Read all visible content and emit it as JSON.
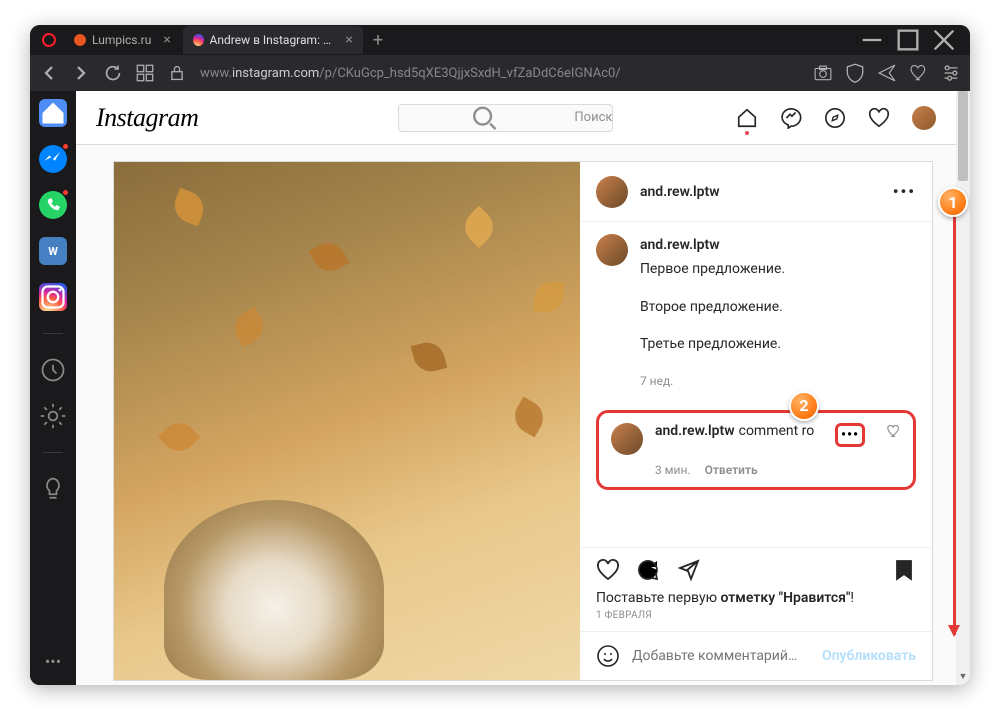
{
  "browser": {
    "tabs": [
      {
        "title": "Lumpics.ru",
        "active": false
      },
      {
        "title": "Andrew в Instagram: «  П…",
        "active": true
      }
    ],
    "url_prefix": "www.",
    "url_host": "instagram.com",
    "url_path": "/p/CKuGcp_hsd5qXE3QjjxSxdH_vfZaDdC6eIGNAc0/"
  },
  "instagram": {
    "logo": "Instagram",
    "search_placeholder": "Поиск",
    "post": {
      "author": "and.rew.lptw",
      "caption_user": "and.rew.lptw",
      "caption_lines": [
        "Первое предложение.",
        "Второе предложение.",
        "Третье предложение."
      ],
      "caption_time": "7 нед.",
      "comment": {
        "user": "and.rew.lptw",
        "text": "comment ro",
        "time": "3 мин.",
        "reply": "Ответить"
      },
      "likes_prompt_1": "Поставьте первую ",
      "likes_prompt_2": "отметку \"Нравится\"",
      "likes_prompt_3": "!",
      "date": "1 ФЕВРАЛЯ",
      "add_comment_placeholder": "Добавьте комментарий…",
      "publish": "Опубликовать"
    }
  },
  "annotations": {
    "badge1": "1",
    "badge2": "2"
  }
}
